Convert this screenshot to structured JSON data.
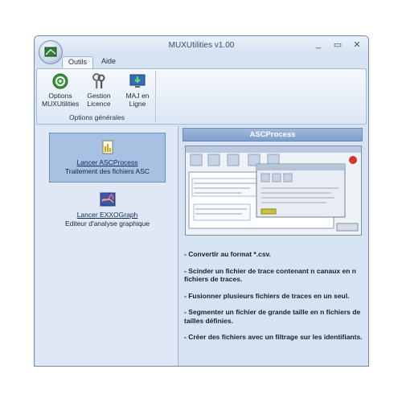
{
  "window": {
    "title": "MUXUtilities v1.00"
  },
  "titlebar_buttons": {
    "minimize": "_",
    "maximize": "▭",
    "close": "✕"
  },
  "tabs": [
    {
      "label": "Outils",
      "active": true
    },
    {
      "label": "Aide",
      "active": false
    }
  ],
  "ribbon": {
    "group_label": "Options générales",
    "buttons": [
      {
        "label": "Options\nMUXUtilities",
        "icon": "gear-icon"
      },
      {
        "label": "Gestion\nLicence",
        "icon": "keys-icon"
      },
      {
        "label": "MAJ en\nLigne",
        "icon": "update-monitor-icon"
      }
    ]
  },
  "launchers": [
    {
      "title": "Lancer ASCProcess",
      "subtitle": "Traitement des fichiers ASC",
      "icon": "document-icon",
      "selected": true
    },
    {
      "title": "Lancer EXXOGraph",
      "subtitle": "Editeur d'analyse graphique",
      "icon": "graph-icon",
      "selected": false
    }
  ],
  "panel": {
    "header": "ASCProcess",
    "description": [
      "- Convertir au format *.csv.",
      "- Scinder un fichier de trace contenant n canaux en n fichiers de traces.",
      "- Fusionner plusieurs fichiers de traces en un seul.",
      "- Segmenter un fichier de grande taille en n fichiers de tailles définies.",
      "- Créer des fichiers avec un filtrage sur les identifiants."
    ]
  },
  "colors": {
    "accent": "#7f9fcb",
    "selection": "#a7c1e3",
    "background": "#d6e3f2"
  }
}
